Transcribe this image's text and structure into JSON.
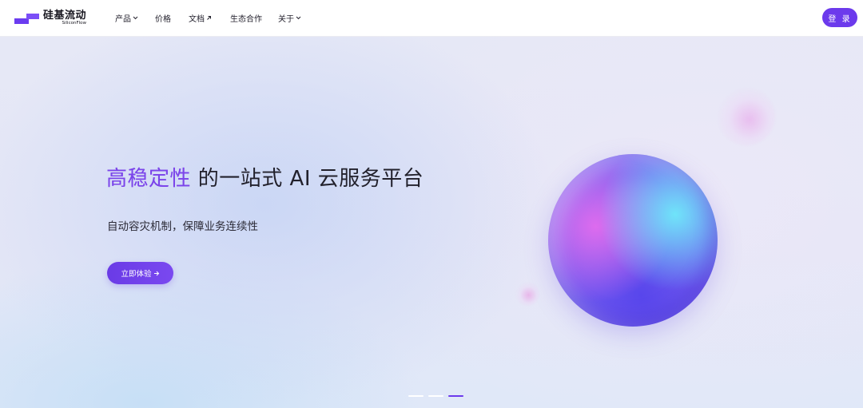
{
  "brand": {
    "name_cn": "硅基流动",
    "name_en": "SiliconFlow",
    "logo_icon": "siliconflow-logo-icon"
  },
  "nav": {
    "items": [
      {
        "label": "产品",
        "icon": "chevron-down-icon"
      },
      {
        "label": "价格"
      },
      {
        "label": "文档",
        "icon": "external-link-icon"
      },
      {
        "label": "生态合作"
      },
      {
        "label": "关于",
        "icon": "chevron-down-icon"
      }
    ],
    "login_label": "登 录"
  },
  "hero": {
    "title_accent": "高稳定性",
    "title_rest": " 的一站式 AI 云服务平台",
    "subtitle": "自动容灾机制，保障业务连续性",
    "cta_label": "立即体验",
    "cta_icon": "arrow-right-icon"
  },
  "carousel": {
    "slide_count": 3,
    "active_index": 2
  },
  "colors": {
    "accent": "#6c3aec",
    "text_dark": "#22212c"
  }
}
